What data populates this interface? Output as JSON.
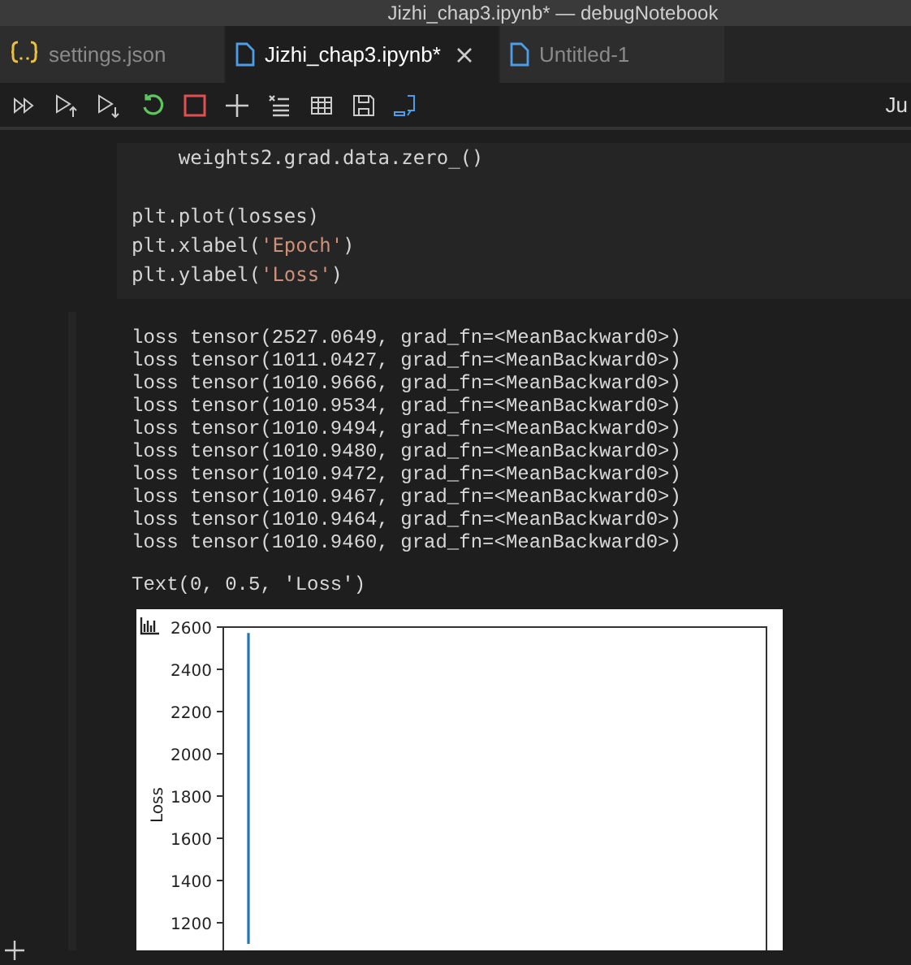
{
  "window": {
    "title": "Jizhi_chap3.ipynb* — debugNotebook"
  },
  "tabs": [
    {
      "label": "settings.json",
      "kind": "json",
      "selected": false
    },
    {
      "label": "Jizhi_chap3.ipynb*",
      "kind": "file",
      "selected": true
    },
    {
      "label": "Untitled-1",
      "kind": "file",
      "selected": false
    }
  ],
  "toolbar": {
    "right_text": "Ju"
  },
  "code_cell": {
    "blocks": [
      [
        [
          {
            "t": "    weights2.grad.data.zero_()",
            "kind": "plain"
          }
        ]
      ],
      [
        [
          {
            "t": "plt.plot(losses)",
            "kind": "plain"
          }
        ],
        [
          {
            "t": "plt.xlabel(",
            "kind": "plain"
          },
          {
            "t": "'Epoch'",
            "kind": "string"
          },
          {
            "t": ")",
            "kind": "plain"
          }
        ],
        [
          {
            "t": "plt.ylabel(",
            "kind": "plain"
          },
          {
            "t": "'Loss'",
            "kind": "string"
          },
          {
            "t": ")",
            "kind": "plain"
          }
        ]
      ]
    ]
  },
  "output": {
    "lines": [
      "loss tensor(2527.0649, grad_fn=<MeanBackward0>)",
      "loss tensor(1011.0427, grad_fn=<MeanBackward0>)",
      "loss tensor(1010.9666, grad_fn=<MeanBackward0>)",
      "loss tensor(1010.9534, grad_fn=<MeanBackward0>)",
      "loss tensor(1010.9494, grad_fn=<MeanBackward0>)",
      "loss tensor(1010.9480, grad_fn=<MeanBackward0>)",
      "loss tensor(1010.9472, grad_fn=<MeanBackward0>)",
      "loss tensor(1010.9467, grad_fn=<MeanBackward0>)",
      "loss tensor(1010.9464, grad_fn=<MeanBackward0>)",
      "loss tensor(1010.9460, grad_fn=<MeanBackward0>)"
    ],
    "result": "Text(0, 0.5, 'Loss')",
    "plot": {
      "ylabel": "Loss",
      "yticks": [
        "2600",
        "2400",
        "2200",
        "2000",
        "1800",
        "1600",
        "1400",
        "1200"
      ]
    }
  }
}
